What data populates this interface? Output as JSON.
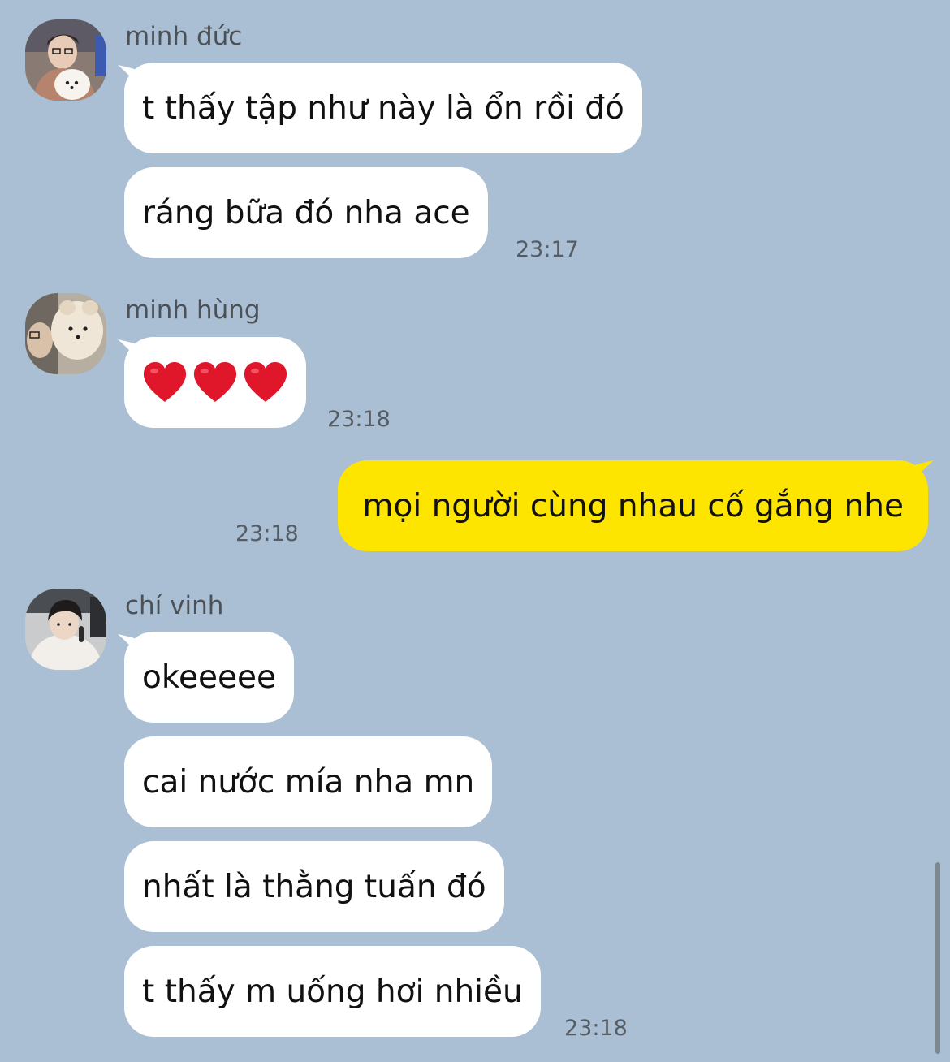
{
  "messages": [
    {
      "sender": "minh đức",
      "bubbles": [
        "t thấy tập như này là ổn rồi đó",
        "ráng bữa đó nha ace"
      ],
      "time": "23:17"
    },
    {
      "sender": "minh hùng",
      "bubbles": [
        "❤️❤️❤️"
      ],
      "time": "23:18"
    },
    {
      "sender": "me",
      "bubbles": [
        "mọi người cùng nhau cố gắng nhe"
      ],
      "time": "23:18"
    },
    {
      "sender": "chí vinh",
      "bubbles": [
        "okeeeee",
        "cai nước mía nha mn",
        "nhất là thằng tuấn đó",
        "t thấy m uống hơi nhiều"
      ],
      "time": "23:18"
    }
  ],
  "colors": {
    "background": "#aabfd3",
    "incoming_bubble": "#ffffff",
    "outgoing_bubble": "#fee500",
    "heart": "#e0162b"
  }
}
